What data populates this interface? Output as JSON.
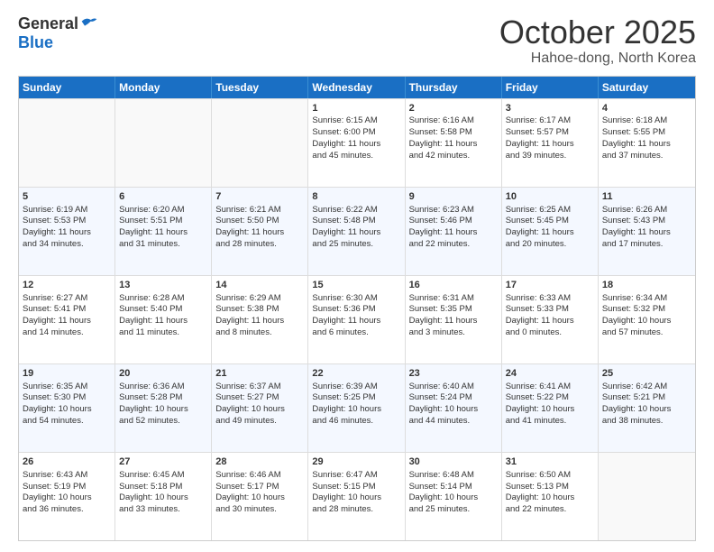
{
  "logo": {
    "general": "General",
    "blue": "Blue"
  },
  "title": "October 2025",
  "location": "Hahoe-dong, North Korea",
  "days_of_week": [
    "Sunday",
    "Monday",
    "Tuesday",
    "Wednesday",
    "Thursday",
    "Friday",
    "Saturday"
  ],
  "weeks": [
    [
      {
        "day": "",
        "lines": []
      },
      {
        "day": "",
        "lines": []
      },
      {
        "day": "",
        "lines": []
      },
      {
        "day": "1",
        "lines": [
          "Sunrise: 6:15 AM",
          "Sunset: 6:00 PM",
          "Daylight: 11 hours",
          "and 45 minutes."
        ]
      },
      {
        "day": "2",
        "lines": [
          "Sunrise: 6:16 AM",
          "Sunset: 5:58 PM",
          "Daylight: 11 hours",
          "and 42 minutes."
        ]
      },
      {
        "day": "3",
        "lines": [
          "Sunrise: 6:17 AM",
          "Sunset: 5:57 PM",
          "Daylight: 11 hours",
          "and 39 minutes."
        ]
      },
      {
        "day": "4",
        "lines": [
          "Sunrise: 6:18 AM",
          "Sunset: 5:55 PM",
          "Daylight: 11 hours",
          "and 37 minutes."
        ]
      }
    ],
    [
      {
        "day": "5",
        "lines": [
          "Sunrise: 6:19 AM",
          "Sunset: 5:53 PM",
          "Daylight: 11 hours",
          "and 34 minutes."
        ]
      },
      {
        "day": "6",
        "lines": [
          "Sunrise: 6:20 AM",
          "Sunset: 5:51 PM",
          "Daylight: 11 hours",
          "and 31 minutes."
        ]
      },
      {
        "day": "7",
        "lines": [
          "Sunrise: 6:21 AM",
          "Sunset: 5:50 PM",
          "Daylight: 11 hours",
          "and 28 minutes."
        ]
      },
      {
        "day": "8",
        "lines": [
          "Sunrise: 6:22 AM",
          "Sunset: 5:48 PM",
          "Daylight: 11 hours",
          "and 25 minutes."
        ]
      },
      {
        "day": "9",
        "lines": [
          "Sunrise: 6:23 AM",
          "Sunset: 5:46 PM",
          "Daylight: 11 hours",
          "and 22 minutes."
        ]
      },
      {
        "day": "10",
        "lines": [
          "Sunrise: 6:25 AM",
          "Sunset: 5:45 PM",
          "Daylight: 11 hours",
          "and 20 minutes."
        ]
      },
      {
        "day": "11",
        "lines": [
          "Sunrise: 6:26 AM",
          "Sunset: 5:43 PM",
          "Daylight: 11 hours",
          "and 17 minutes."
        ]
      }
    ],
    [
      {
        "day": "12",
        "lines": [
          "Sunrise: 6:27 AM",
          "Sunset: 5:41 PM",
          "Daylight: 11 hours",
          "and 14 minutes."
        ]
      },
      {
        "day": "13",
        "lines": [
          "Sunrise: 6:28 AM",
          "Sunset: 5:40 PM",
          "Daylight: 11 hours",
          "and 11 minutes."
        ]
      },
      {
        "day": "14",
        "lines": [
          "Sunrise: 6:29 AM",
          "Sunset: 5:38 PM",
          "Daylight: 11 hours",
          "and 8 minutes."
        ]
      },
      {
        "day": "15",
        "lines": [
          "Sunrise: 6:30 AM",
          "Sunset: 5:36 PM",
          "Daylight: 11 hours",
          "and 6 minutes."
        ]
      },
      {
        "day": "16",
        "lines": [
          "Sunrise: 6:31 AM",
          "Sunset: 5:35 PM",
          "Daylight: 11 hours",
          "and 3 minutes."
        ]
      },
      {
        "day": "17",
        "lines": [
          "Sunrise: 6:33 AM",
          "Sunset: 5:33 PM",
          "Daylight: 11 hours",
          "and 0 minutes."
        ]
      },
      {
        "day": "18",
        "lines": [
          "Sunrise: 6:34 AM",
          "Sunset: 5:32 PM",
          "Daylight: 10 hours",
          "and 57 minutes."
        ]
      }
    ],
    [
      {
        "day": "19",
        "lines": [
          "Sunrise: 6:35 AM",
          "Sunset: 5:30 PM",
          "Daylight: 10 hours",
          "and 54 minutes."
        ]
      },
      {
        "day": "20",
        "lines": [
          "Sunrise: 6:36 AM",
          "Sunset: 5:28 PM",
          "Daylight: 10 hours",
          "and 52 minutes."
        ]
      },
      {
        "day": "21",
        "lines": [
          "Sunrise: 6:37 AM",
          "Sunset: 5:27 PM",
          "Daylight: 10 hours",
          "and 49 minutes."
        ]
      },
      {
        "day": "22",
        "lines": [
          "Sunrise: 6:39 AM",
          "Sunset: 5:25 PM",
          "Daylight: 10 hours",
          "and 46 minutes."
        ]
      },
      {
        "day": "23",
        "lines": [
          "Sunrise: 6:40 AM",
          "Sunset: 5:24 PM",
          "Daylight: 10 hours",
          "and 44 minutes."
        ]
      },
      {
        "day": "24",
        "lines": [
          "Sunrise: 6:41 AM",
          "Sunset: 5:22 PM",
          "Daylight: 10 hours",
          "and 41 minutes."
        ]
      },
      {
        "day": "25",
        "lines": [
          "Sunrise: 6:42 AM",
          "Sunset: 5:21 PM",
          "Daylight: 10 hours",
          "and 38 minutes."
        ]
      }
    ],
    [
      {
        "day": "26",
        "lines": [
          "Sunrise: 6:43 AM",
          "Sunset: 5:19 PM",
          "Daylight: 10 hours",
          "and 36 minutes."
        ]
      },
      {
        "day": "27",
        "lines": [
          "Sunrise: 6:45 AM",
          "Sunset: 5:18 PM",
          "Daylight: 10 hours",
          "and 33 minutes."
        ]
      },
      {
        "day": "28",
        "lines": [
          "Sunrise: 6:46 AM",
          "Sunset: 5:17 PM",
          "Daylight: 10 hours",
          "and 30 minutes."
        ]
      },
      {
        "day": "29",
        "lines": [
          "Sunrise: 6:47 AM",
          "Sunset: 5:15 PM",
          "Daylight: 10 hours",
          "and 28 minutes."
        ]
      },
      {
        "day": "30",
        "lines": [
          "Sunrise: 6:48 AM",
          "Sunset: 5:14 PM",
          "Daylight: 10 hours",
          "and 25 minutes."
        ]
      },
      {
        "day": "31",
        "lines": [
          "Sunrise: 6:50 AM",
          "Sunset: 5:13 PM",
          "Daylight: 10 hours",
          "and 22 minutes."
        ]
      },
      {
        "day": "",
        "lines": []
      }
    ]
  ]
}
